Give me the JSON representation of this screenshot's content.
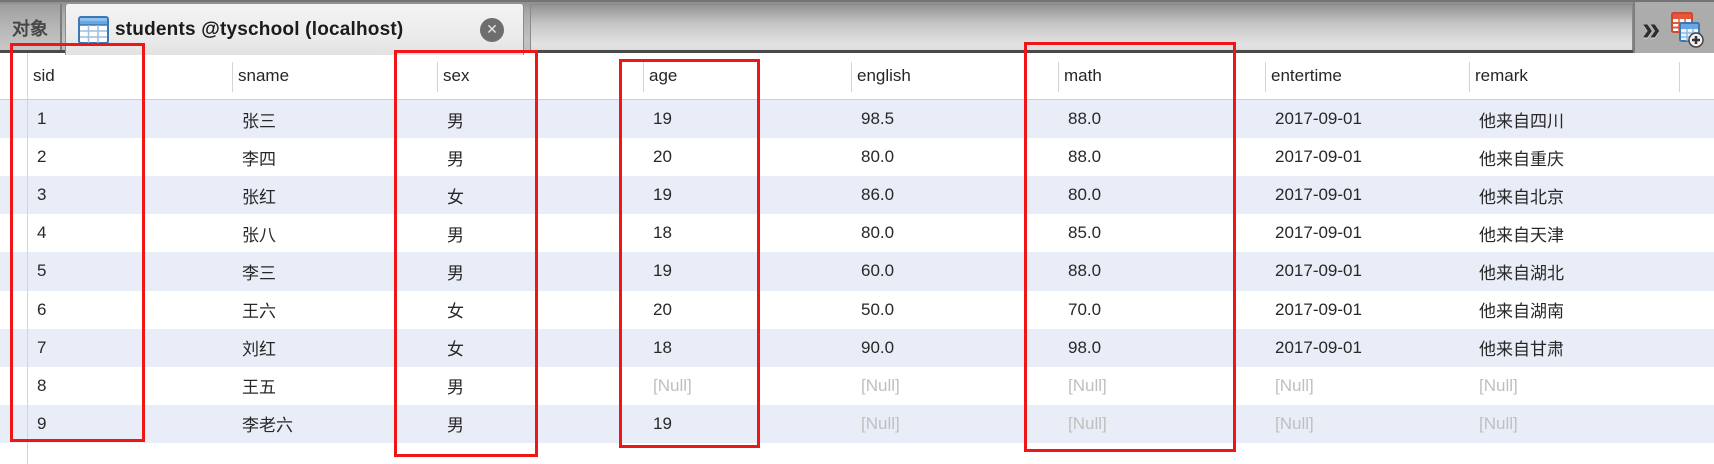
{
  "tabbar": {
    "objects_tab_label": "对象",
    "active_tab": {
      "title": "students @tyschool (localhost)",
      "close_glyph": "✕"
    },
    "overflow_chevron": "»"
  },
  "grid": {
    "columns": [
      "sid",
      "sname",
      "sex",
      "age",
      "english",
      "math",
      "entertime",
      "remark"
    ],
    "null_text": "[Null]",
    "rows": [
      [
        "1",
        "张三",
        "男",
        "19",
        "98.5",
        "88.0",
        "2017-09-01",
        "他来自四川"
      ],
      [
        "2",
        "李四",
        "男",
        "20",
        "80.0",
        "88.0",
        "2017-09-01",
        "他来自重庆"
      ],
      [
        "3",
        "张红",
        "女",
        "19",
        "86.0",
        "80.0",
        "2017-09-01",
        "他来自北京"
      ],
      [
        "4",
        "张八",
        "男",
        "18",
        "80.0",
        "85.0",
        "2017-09-01",
        "他来自天津"
      ],
      [
        "5",
        "李三",
        "男",
        "19",
        "60.0",
        "88.0",
        "2017-09-01",
        "他来自湖北"
      ],
      [
        "6",
        "王六",
        "女",
        "20",
        "50.0",
        "70.0",
        "2017-09-01",
        "他来自湖南"
      ],
      [
        "7",
        "刘红",
        "女",
        "18",
        "90.0",
        "98.0",
        "2017-09-01",
        "他来自甘肃"
      ],
      [
        "8",
        "王五",
        "男",
        "[Null]",
        "[Null]",
        "[Null]",
        "[Null]",
        "[Null]"
      ],
      [
        "9",
        "李老六",
        "男",
        "19",
        "[Null]",
        "[Null]",
        "[Null]",
        "[Null]"
      ]
    ]
  },
  "annotations": {
    "highlighted_columns": [
      "sid",
      "sex",
      "age",
      "math"
    ],
    "color": "#ee1616"
  },
  "colors": {
    "row_stripe": "#E9EDF7",
    "null_text": "#bfbfbf",
    "cell_text": "#282828",
    "tab_bar_dark_border": "#4a4a4a",
    "active_tab_bg": "#efefef"
  }
}
